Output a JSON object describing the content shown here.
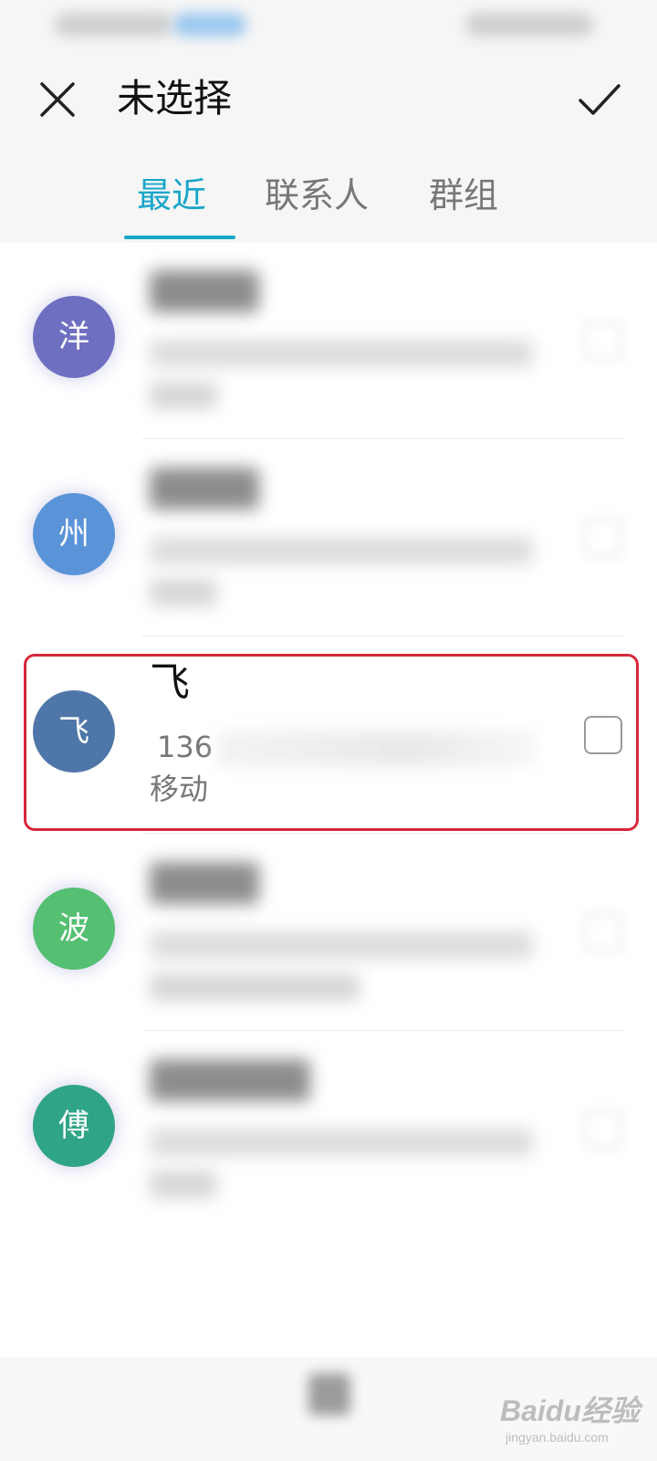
{
  "header": {
    "title": "未选择",
    "close_icon": "close-icon",
    "confirm_icon": "checkmark-icon"
  },
  "tabs": [
    {
      "label": "最近",
      "active": true
    },
    {
      "label": "联系人",
      "active": false
    },
    {
      "label": "群组",
      "active": false
    }
  ],
  "contacts": [
    {
      "avatar_char": "洋",
      "avatar_color": "#6f6fc2",
      "name": "",
      "phone": "",
      "carrier": "",
      "blurred": true
    },
    {
      "avatar_char": "州",
      "avatar_color": "#5a93d8",
      "name": "",
      "phone": "",
      "carrier": "",
      "blurred": true
    },
    {
      "avatar_char": "飞",
      "avatar_color": "#4f76a8",
      "name": "飞",
      "phone": "136",
      "carrier": "移动",
      "blurred": false,
      "highlighted": true
    },
    {
      "avatar_char": "波",
      "avatar_color": "#55bf72",
      "name": "",
      "phone": "",
      "carrier": "",
      "blurred": true
    },
    {
      "avatar_char": "傅",
      "avatar_color": "#2fa486",
      "name": "",
      "phone": "",
      "carrier": "",
      "blurred": true
    }
  ],
  "colors": {
    "accent": "#1aa6c9",
    "highlight_border": "#d8283b"
  },
  "watermark": {
    "main": "Baidu经验",
    "sub": "jingyan.baidu.com"
  }
}
